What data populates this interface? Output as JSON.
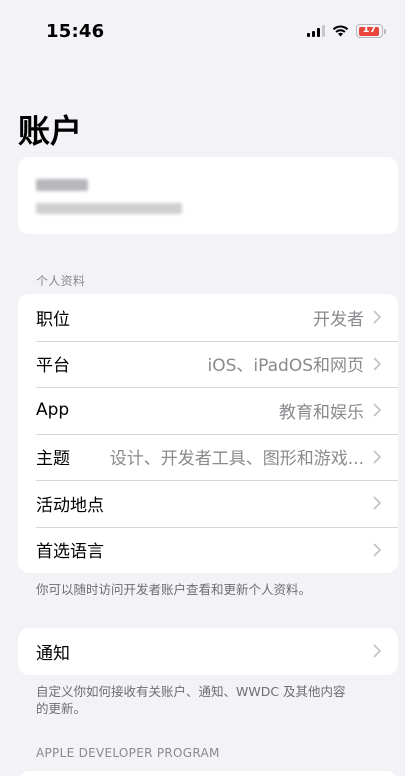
{
  "status_bar": {
    "time": "15:46",
    "battery": "17"
  },
  "page": {
    "title": "账户"
  },
  "personal_section": {
    "header": "个人资料",
    "rows": [
      {
        "label": "职位",
        "value": "开发者"
      },
      {
        "label": "平台",
        "value": "iOS、iPadOS和网页"
      },
      {
        "label": "App",
        "value": "教育和娱乐"
      },
      {
        "label": "主题",
        "value": "设计、开发者工具、图形和游戏..."
      },
      {
        "label": "活动地点",
        "value": ""
      },
      {
        "label": "首选语言",
        "value": ""
      }
    ],
    "footer": "你可以随时访问开发者账户查看和更新个人资料。"
  },
  "notifications_section": {
    "rows": [
      {
        "label": "通知",
        "value": ""
      }
    ],
    "footer": "自定义你如何接收有关账户、通知、WWDC 及其他内容的更新。"
  },
  "program_section": {
    "header": "APPLE DEVELOPER PROGRAM"
  },
  "colors": {
    "background": "#f2f2f7",
    "card": "#ffffff",
    "secondary_text": "#8a8a8e",
    "battery_low": "#e8463c"
  },
  "icons": [
    "signal-icon",
    "wifi-icon",
    "battery-icon",
    "chevron-right-icon"
  ]
}
